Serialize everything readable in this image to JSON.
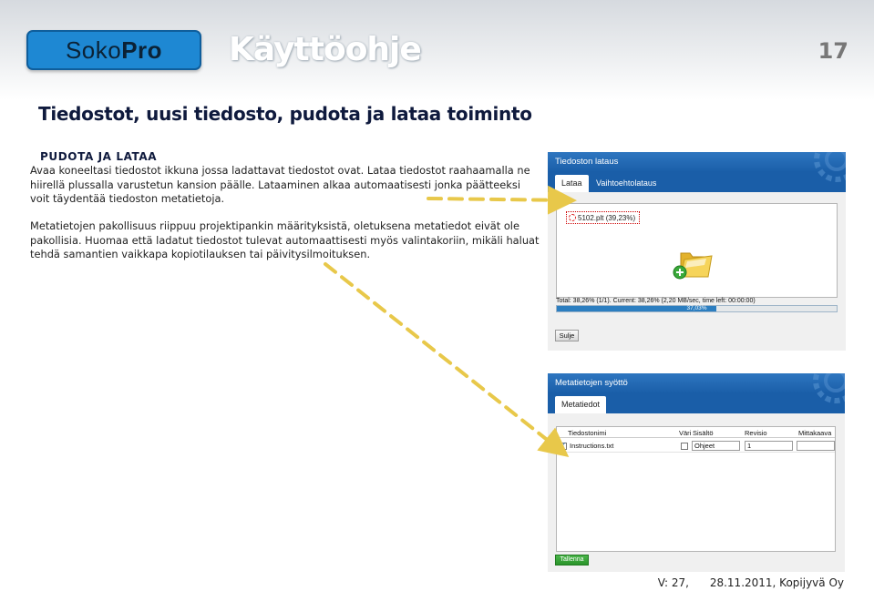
{
  "header": {
    "logo_part1": "Soko",
    "logo_part2": "Pro",
    "title": "Käyttöohje",
    "page_number": "17"
  },
  "page_heading": "Tiedostot, uusi tiedosto, pudota ja lataa toiminto",
  "section": {
    "heading": "PUDOTA JA LATAA",
    "paragraph1": "Avaa koneeltasi tiedostot ikkuna jossa ladattavat tiedostot ovat. Lataa tiedostot raahaamalla ne hiirellä plussalla varustetun kansion päälle. Lataaminen alkaa automaatisesti jonka päätteeksi voit täydentää tiedoston metatietoja.",
    "paragraph2": "Metatietojen pakollisuus riippuu projektipankin määrityksistä, oletuksena metatiedot eivät ole pakollisia. Huomaa että ladatut tiedostot tulevat automaattisesti myös valintakoriin, mikäli haluat tehdä samantien vaikkapa kopiotilauksen tai päivitysilmoituksen."
  },
  "upload_dialog": {
    "title": "Tiedoston lataus",
    "tab_upload": "Lataa",
    "tab_alt": "Vaihtoehtolataus",
    "file_entry": "5102.plt (39,23%)",
    "status": "Total: 38,26% (1/1). Current: 38,26% (2,20 MB/sec, time left: 00:00:00)",
    "progress_label": "37,03%",
    "progress_fraction": 0.57,
    "close_label": "Sulje"
  },
  "meta_dialog": {
    "title": "Metatietojen syöttö",
    "tab_metadata": "Metatiedot",
    "columns": [
      "Tiedostonimi",
      "Väri",
      "Sisältö",
      "Revisio",
      "Mittakaava"
    ],
    "row": {
      "filename": "Instructions.txt",
      "content": "Ohjeet",
      "revision": "1"
    },
    "save_label": "Tallenna"
  },
  "footer": "V: 27,      28.11.2011, Kopijyvä Oy",
  "colors": {
    "heading_navy": "#0f1a3d",
    "logo_blue": "#1e88d3",
    "dialog_blue": "#1a5ea8",
    "arrow_yellow": "#e8c84a"
  }
}
